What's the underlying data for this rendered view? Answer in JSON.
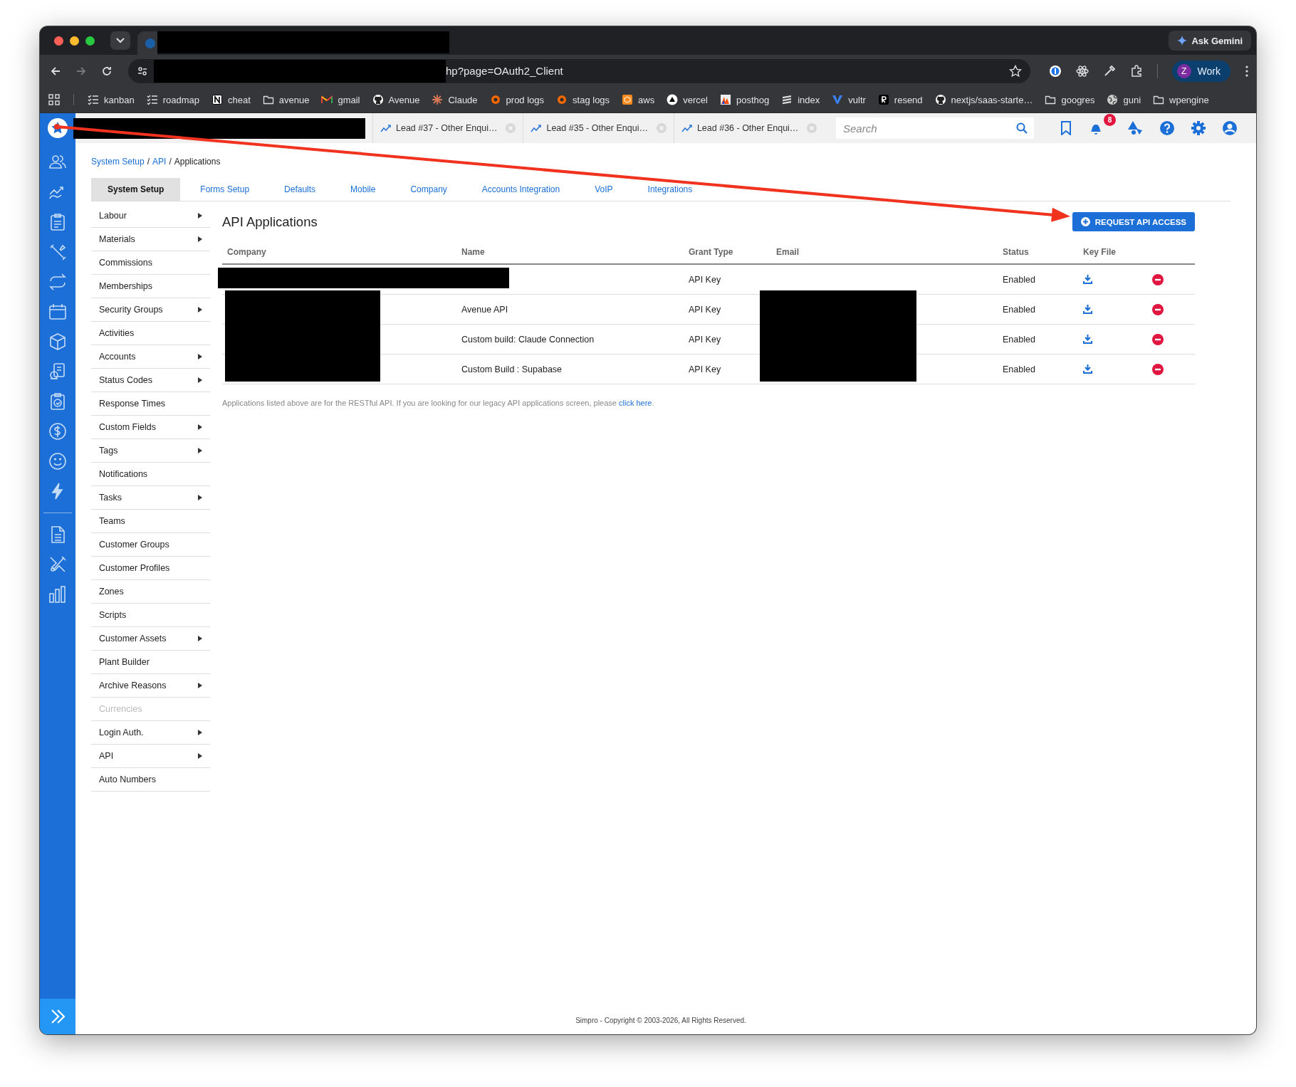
{
  "browser": {
    "address": "hp?page=OAuth2_Client",
    "ask_button": "Ask Gemini",
    "profile": {
      "initial": "Z",
      "label": "Work"
    },
    "bookmarks": [
      {
        "label": "kanban",
        "kind": "list"
      },
      {
        "label": "roadmap",
        "kind": "list"
      },
      {
        "label": "cheat",
        "kind": "notion"
      },
      {
        "label": "avenue",
        "kind": "folder"
      },
      {
        "label": "gmail",
        "kind": "mail"
      },
      {
        "label": "Avenue",
        "kind": "github"
      },
      {
        "label": "Claude",
        "kind": "spark"
      },
      {
        "label": "prod logs",
        "kind": "swirl"
      },
      {
        "label": "stag logs",
        "kind": "swirl"
      },
      {
        "label": "aws",
        "kind": "cube"
      },
      {
        "label": "vercel",
        "kind": "triangle"
      },
      {
        "label": "posthog",
        "kind": "bars"
      },
      {
        "label": "index",
        "kind": "stack"
      },
      {
        "label": "vultr",
        "kind": "v"
      },
      {
        "label": "resend",
        "kind": "r"
      },
      {
        "label": "nextjs/saas-starte…",
        "kind": "github"
      },
      {
        "label": "googres",
        "kind": "folder"
      },
      {
        "label": "guni",
        "kind": "globe"
      },
      {
        "label": "wpengine",
        "kind": "folder"
      }
    ]
  },
  "app_tabs": [
    {
      "label": "Lead #37 - Other Enqui…"
    },
    {
      "label": "Lead #35 - Other Enqui…"
    },
    {
      "label": "Lead #36 - Other Enqui…"
    }
  ],
  "search": {
    "placeholder": "Search"
  },
  "notifications": {
    "count": "8"
  },
  "breadcrumb": [
    {
      "text": "System Setup",
      "kind": "link"
    },
    {
      "text": "/",
      "kind": "separator"
    },
    {
      "text": "API",
      "kind": "link"
    },
    {
      "text": "/",
      "kind": "separator"
    },
    {
      "text": "Applications",
      "kind": "current"
    }
  ],
  "setup_tabs": [
    {
      "label": "System Setup",
      "selected": true
    },
    {
      "label": "Forms Setup",
      "selected": false
    },
    {
      "label": "Defaults",
      "selected": false
    },
    {
      "label": "Mobile",
      "selected": false
    },
    {
      "label": "Company",
      "selected": false
    },
    {
      "label": "Accounts Integration",
      "selected": false
    },
    {
      "label": "VoIP",
      "selected": false
    },
    {
      "label": "Integrations",
      "selected": false
    }
  ],
  "menu": [
    {
      "label": "Labour",
      "submenu": true,
      "disabled": false
    },
    {
      "label": "Materials",
      "submenu": true,
      "disabled": false
    },
    {
      "label": "Commissions",
      "submenu": false,
      "disabled": false
    },
    {
      "label": "Memberships",
      "submenu": false,
      "disabled": false
    },
    {
      "label": "Security Groups",
      "submenu": true,
      "disabled": false
    },
    {
      "label": "Activities",
      "submenu": false,
      "disabled": false
    },
    {
      "label": "Accounts",
      "submenu": true,
      "disabled": false
    },
    {
      "label": "Status Codes",
      "submenu": true,
      "disabled": false
    },
    {
      "label": "Response Times",
      "submenu": false,
      "disabled": false
    },
    {
      "label": "Custom Fields",
      "submenu": true,
      "disabled": false
    },
    {
      "label": "Tags",
      "submenu": true,
      "disabled": false
    },
    {
      "label": "Notifications",
      "submenu": false,
      "disabled": false
    },
    {
      "label": "Tasks",
      "submenu": true,
      "disabled": false
    },
    {
      "label": "Teams",
      "submenu": false,
      "disabled": false
    },
    {
      "label": "Customer Groups",
      "submenu": false,
      "disabled": false
    },
    {
      "label": "Customer Profiles",
      "submenu": false,
      "disabled": false
    },
    {
      "label": "Zones",
      "submenu": false,
      "disabled": false
    },
    {
      "label": "Scripts",
      "submenu": false,
      "disabled": false
    },
    {
      "label": "Customer Assets",
      "submenu": true,
      "disabled": false
    },
    {
      "label": "Plant Builder",
      "submenu": false,
      "disabled": false
    },
    {
      "label": "Archive Reasons",
      "submenu": true,
      "disabled": false
    },
    {
      "label": "Currencies",
      "submenu": false,
      "disabled": true
    },
    {
      "label": "Login Auth.",
      "submenu": true,
      "disabled": false
    },
    {
      "label": "API",
      "submenu": true,
      "disabled": false
    },
    {
      "label": "Auto Numbers",
      "submenu": false,
      "disabled": false
    }
  ],
  "page_title": "API Applications",
  "request_button": "REQUEST API ACCESS",
  "table": {
    "columns": [
      "Company",
      "Name",
      "Grant Type",
      "Email",
      "Status",
      "Key File"
    ],
    "rows": [
      {
        "grant_type": "API Key",
        "status": "Enabled"
      },
      {
        "name": "Avenue API",
        "grant_type": "API Key",
        "status": "Enabled"
      },
      {
        "name": "Custom build: Claude Connection",
        "grant_type": "API Key",
        "status": "Enabled"
      },
      {
        "name": "Custom Build : Supabase",
        "grant_type": "API Key",
        "status": "Enabled"
      }
    ]
  },
  "note": {
    "text": "Applications listed above are for the RESTful API. If you are looking for our legacy API applications screen, please ",
    "link": "click here",
    "after": "."
  },
  "footer": "Simpro - Copyright © 2003-2026, All Rights Reserved."
}
